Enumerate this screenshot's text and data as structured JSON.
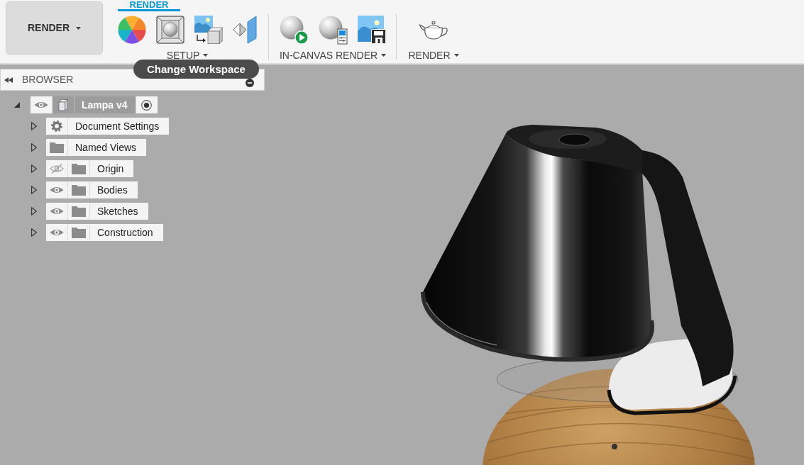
{
  "workspace_button": {
    "label": "RENDER"
  },
  "tabs": [
    {
      "label": "RENDER",
      "selected": true
    }
  ],
  "toolbar_groups": [
    {
      "label": "SETUP"
    },
    {
      "label": "IN-CANVAS RENDER"
    },
    {
      "label": "RENDER"
    }
  ],
  "tooltip": {
    "text": "Change Workspace"
  },
  "browser": {
    "title": "BROWSER",
    "tree": [
      {
        "kind": "component",
        "label": "Lampa v4",
        "expanded": true,
        "visible": true,
        "active": true,
        "children": [
          {
            "kind": "settings",
            "label": "Document Settings",
            "expanded": false
          },
          {
            "kind": "views",
            "label": "Named Views",
            "expanded": false
          },
          {
            "kind": "folder",
            "label": "Origin",
            "expanded": false,
            "visible": false
          },
          {
            "kind": "folder",
            "label": "Bodies",
            "expanded": false,
            "visible": true
          },
          {
            "kind": "folder",
            "label": "Sketches",
            "expanded": false,
            "visible": true
          },
          {
            "kind": "folder",
            "label": "Construction",
            "expanded": false,
            "visible": true
          }
        ]
      }
    ]
  }
}
